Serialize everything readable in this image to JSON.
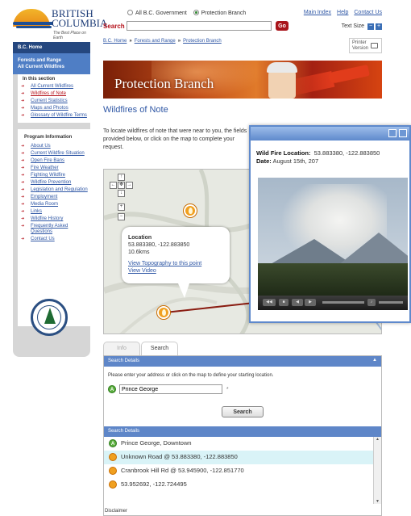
{
  "header": {
    "logo_line1": "BRITISH",
    "logo_line2": "COLUMBIA",
    "logo_tagline": "The Best Place on Earth",
    "scope_option1": "All B.C. Government",
    "scope_option2": "Protection Branch",
    "search_label": "Search",
    "search_value": "",
    "search_go": "Go",
    "links": [
      "Main Index",
      "Help",
      "Contact Us"
    ],
    "text_size_label": "Text Size"
  },
  "breadcrumb": [
    "B.C. Home",
    "Forests and Range",
    "Protection Branch"
  ],
  "printer": {
    "line1": "Printer",
    "line2": "Version"
  },
  "sidebar": {
    "bc_home": "B.C. Home",
    "section_title_1": "Forests and Range",
    "section_title_2": "All Current Wildfires",
    "in_section_head": "In this section",
    "in_section": [
      "All Current Wildfires",
      "Wildfires of Note",
      "Current Statistics",
      "Maps and Photos",
      "Glossary of Wildfire Terms"
    ],
    "program_head": "Program Information",
    "program": [
      "About Us",
      "Current Wildfire Situation",
      "Open Fire Bans",
      "Fire Weather",
      "Fighting Wildfire",
      "Wildfire Prevention",
      "Legislation and Regulation",
      "Employment",
      "Media Room",
      "Links",
      "Wildfire History",
      "Frequently Asked Questions",
      "Contact Us"
    ]
  },
  "banner": {
    "title": "Protection Branch"
  },
  "page_title": "Wildfires of Note",
  "intro": "To locate wildfires of note that were near to you, the fields provided below, or click on the map to complete your request.",
  "map": {
    "pan_controls": [
      "↑",
      "←",
      "✥",
      "→",
      "↓",
      "+",
      "−"
    ],
    "popup": {
      "title": "Location",
      "coords": "53.883380, -122.883850",
      "distance": "10.6kms",
      "link1": "View Topography to this point",
      "link2": "View Video"
    }
  },
  "tabs": [
    "Info",
    "Search"
  ],
  "panel": {
    "header": "Search Details",
    "note": "Please enter your address or click on the map to define your starting location.",
    "start_badge": "A",
    "start_value": "Prince George",
    "required_mark": "*",
    "search_button": "Search",
    "results_header": "Search Details",
    "results": [
      {
        "badge": "A",
        "kind": "start",
        "text": "Prince George, Downtown"
      },
      {
        "badge": "",
        "kind": "fire",
        "text": "Unknown Road @ 53.883380, -122.883850"
      },
      {
        "badge": "",
        "kind": "fire",
        "text": "Cranbrook Hill Rd @ 53.945900, -122.851770"
      },
      {
        "badge": "",
        "kind": "fire",
        "text": "53.952692, -122.724495"
      }
    ]
  },
  "disclaimer": "Disclaimer",
  "overlay": {
    "location_label": "Wild Fire Location:",
    "location_value": "53.883380, -122.883850",
    "date_label": "Date:",
    "date_value": "August 15th, 207"
  },
  "colors": {
    "brand_red": "#b5121b",
    "link_blue": "#2f57a5",
    "nav_dark": "#25477f",
    "bar_blue": "#5e86c8",
    "fire_orange": "#f0a020"
  }
}
